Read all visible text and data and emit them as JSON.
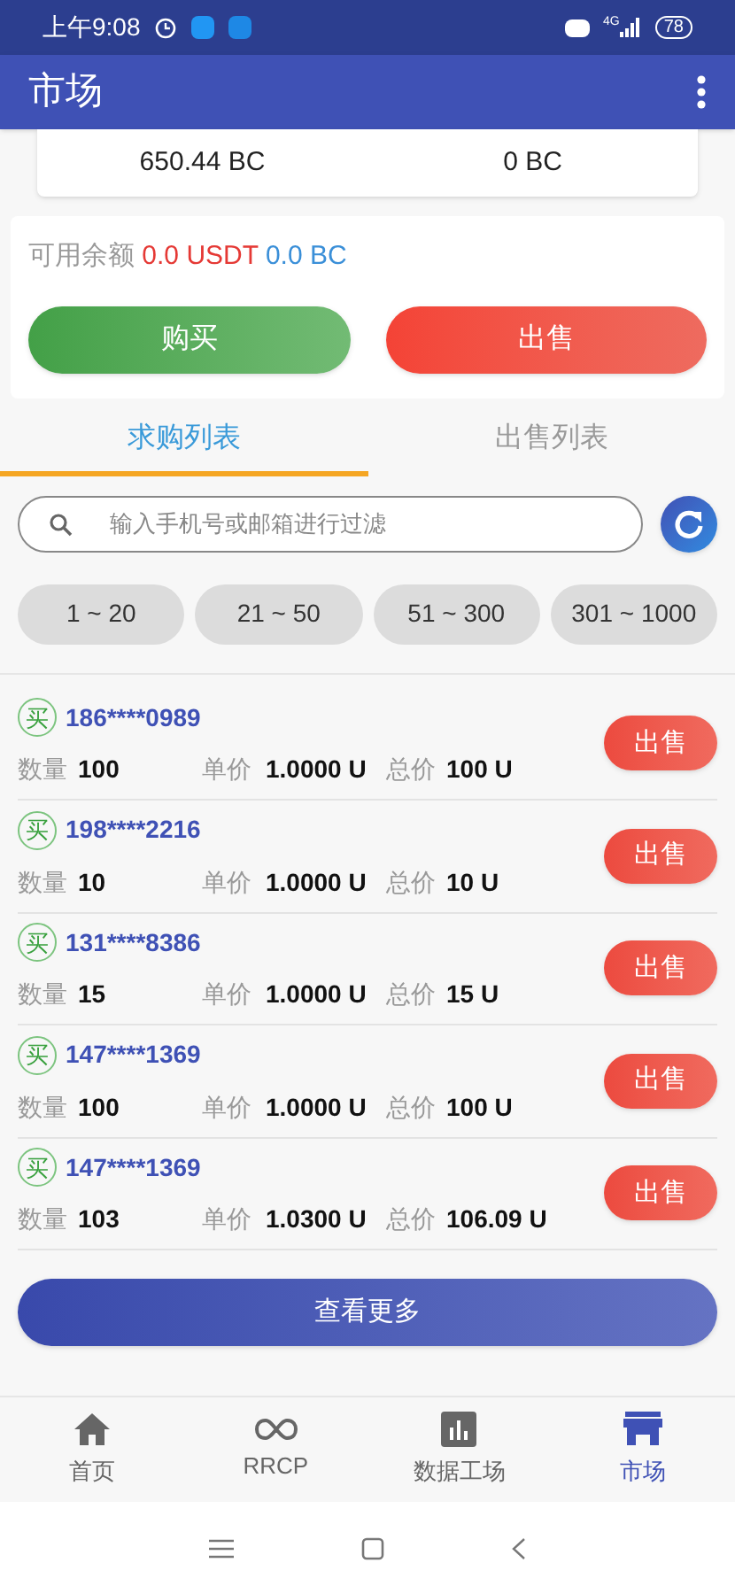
{
  "status_bar": {
    "time": "上午9:08",
    "battery": "78",
    "network": "4G"
  },
  "app_bar": {
    "title": "市场"
  },
  "balances": [
    "650.44 BC",
    "0 BC"
  ],
  "available": {
    "label": "可用余额",
    "usdt": "0.0 USDT",
    "bc": "0.0 BC"
  },
  "actions": [
    {
      "label": "购买",
      "kind": "buy"
    },
    {
      "label": "出售",
      "kind": "sell"
    }
  ],
  "tabs": [
    {
      "label": "求购列表",
      "selected": true
    },
    {
      "label": "出售列表",
      "selected": false
    }
  ],
  "search": {
    "placeholder": "输入手机号或邮箱进行过滤"
  },
  "ranges": [
    {
      "label": "1 ~ 20",
      "selected": false
    },
    {
      "label": "21 ~ 50",
      "selected": false
    },
    {
      "label": "51 ~ 300",
      "selected": false
    },
    {
      "label": "301 ~ 1000",
      "selected": false
    }
  ],
  "orders": [
    {
      "badge": "买",
      "user": "186****0989",
      "qty_label": "数量",
      "qty": "100",
      "price_label": "单价",
      "price": "1.0000 U",
      "total_label": "总价",
      "total": "100 U",
      "action": "出售"
    },
    {
      "badge": "买",
      "user": "198****2216",
      "qty_label": "数量",
      "qty": "10",
      "price_label": "单价",
      "price": "1.0000 U",
      "total_label": "总价",
      "total": "10 U",
      "action": "出售"
    },
    {
      "badge": "买",
      "user": "131****8386",
      "qty_label": "数量",
      "qty": "15",
      "price_label": "单价",
      "price": "1.0000 U",
      "total_label": "总价",
      "total": "15 U",
      "action": "出售"
    },
    {
      "badge": "买",
      "user": "147****1369",
      "qty_label": "数量",
      "qty": "100",
      "price_label": "单价",
      "price": "1.0000 U",
      "total_label": "总价",
      "total": "100 U",
      "action": "出售"
    },
    {
      "badge": "买",
      "user": "147****1369",
      "qty_label": "数量",
      "qty": "103",
      "price_label": "单价",
      "price": "1.0300 U",
      "total_label": "总价",
      "total": "106.09 U",
      "action": "出售"
    }
  ],
  "more_button": "查看更多",
  "bottom_nav": [
    {
      "label": "首页",
      "kind": "home",
      "selected": false
    },
    {
      "label": "RRCP",
      "kind": "infinity",
      "selected": false
    },
    {
      "label": "数据工场",
      "kind": "chart",
      "selected": false
    },
    {
      "label": "市场",
      "kind": "store",
      "selected": true
    }
  ]
}
